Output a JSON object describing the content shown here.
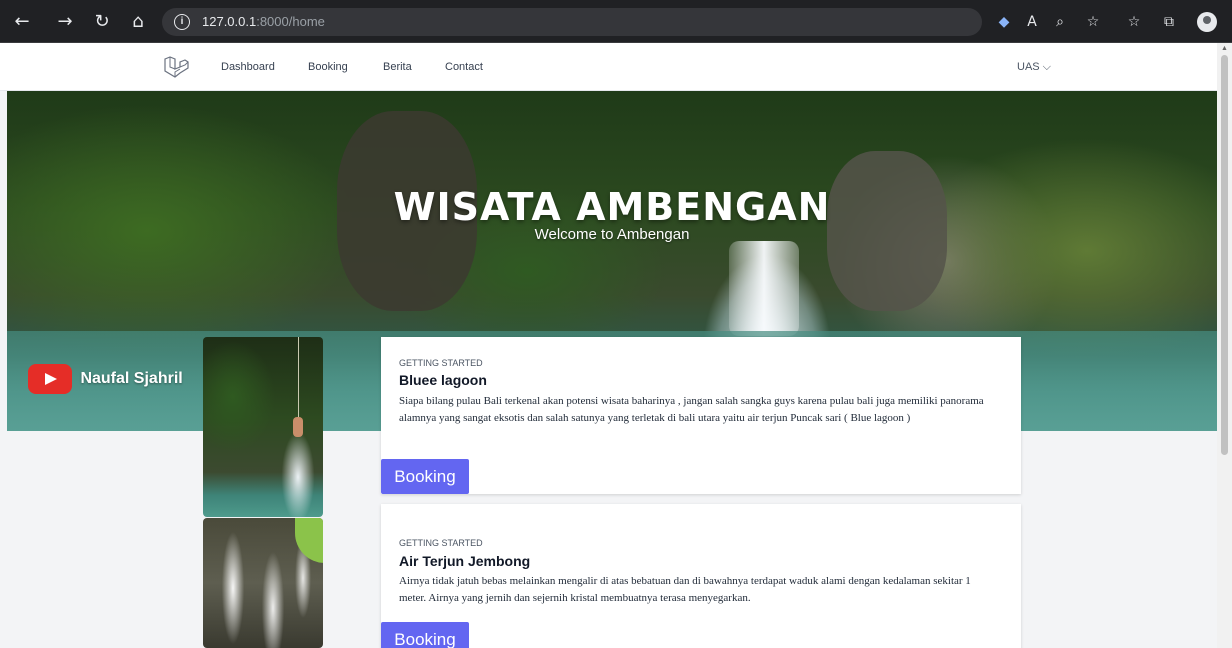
{
  "browser": {
    "url_host": "127.0.0.1",
    "url_rest": ":8000/home"
  },
  "nav": {
    "links": [
      "Dashboard",
      "Booking",
      "Berita",
      "Contact"
    ],
    "user_menu": "UAS ⌵"
  },
  "hero": {
    "title": "WISATA AMBENGAN",
    "subtitle": "Welcome to Ambengan",
    "youtube_name": "Naufal Sjahril"
  },
  "cards": [
    {
      "eyebrow": "GETTING STARTED",
      "title": "Bluee lagoon",
      "description": "Siapa bilang pulau Bali terkenal akan potensi wisata baharinya , jangan salah sangka guys karena pulau bali juga memiliki panorama alamnya yang sangat eksotis dan salah satunya yang terletak di bali utara yaitu air terjun Puncak sari ( Blue lagoon )",
      "button": "Booking"
    },
    {
      "eyebrow": "GETTING STARTED",
      "title": "Air Terjun Jembong",
      "description": "Airnya tidak jatuh bebas melainkan mengalir di atas bebatuan dan di bawahnya terdapat waduk alami dengan kedalaman sekitar 1 meter. Airnya yang jernih dan sejernih kristal membuatnya terasa menyegarkan.",
      "button": "Booking"
    }
  ],
  "colors": {
    "accent": "#6366f1",
    "youtube": "#e52d27"
  }
}
